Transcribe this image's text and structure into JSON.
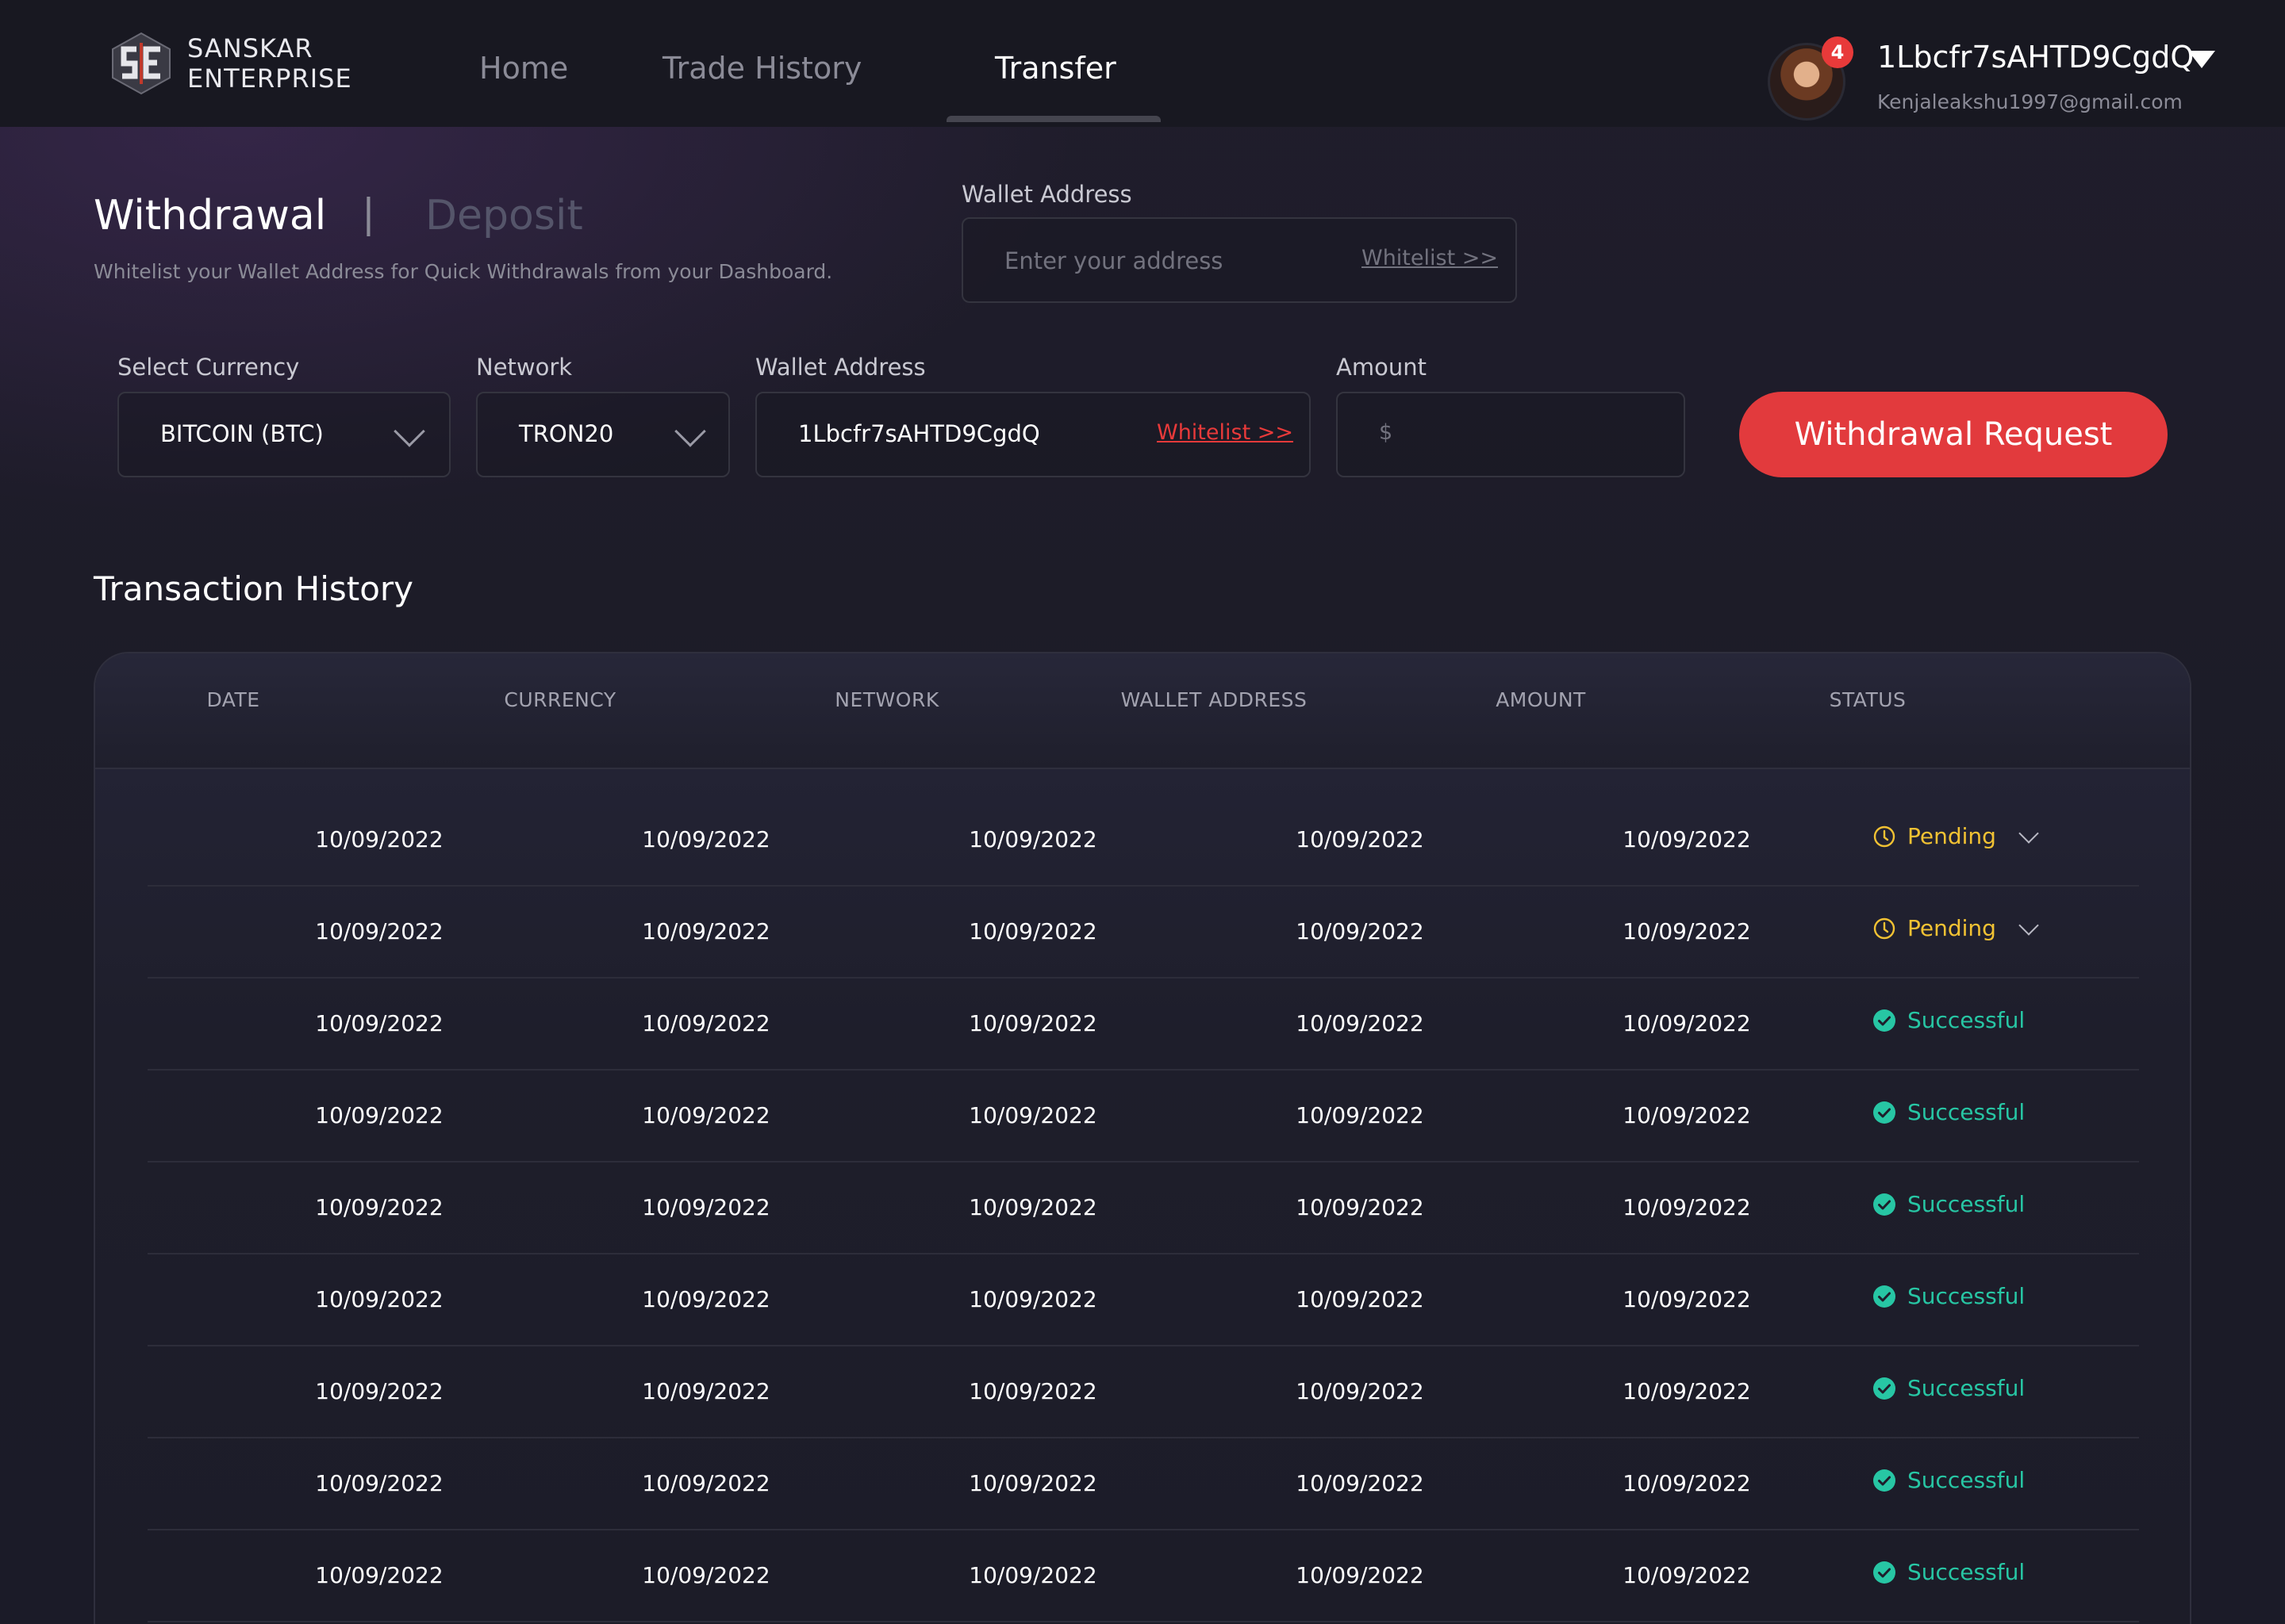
{
  "brand": {
    "name_line1": "SANSKAR",
    "name_line2": "ENTERPRISE"
  },
  "nav": {
    "home": "Home",
    "trade_history": "Trade History",
    "transfer": "Transfer",
    "active": "Transfer"
  },
  "user": {
    "name": "1Lbcfr7sAHTD9CgdQ",
    "email": "Kenjaleakshu1997@gmail.com",
    "notifications": "4"
  },
  "tabs": {
    "withdrawal": "Withdrawal",
    "separator": "|",
    "deposit": "Deposit",
    "active": "Withdrawal"
  },
  "subtitle": "Whitelist your Wallet Address for Quick Withdrawals from your Dashboard.",
  "top_wallet": {
    "label": "Wallet Address",
    "placeholder": "Enter your address",
    "whitelist_link": "Whitelist >>"
  },
  "form": {
    "currency_label": "Select Currency",
    "currency_value": "BITCOIN (BTC)",
    "network_label": "Network",
    "network_value": "TRON20",
    "wallet_label": "Wallet Address",
    "wallet_value": "1Lbcfr7sAHTD9CgdQ",
    "wallet_whitelist": "Whitelist >>",
    "amount_label": "Amount",
    "amount_symbol": "$",
    "submit": "Withdrawal Request",
    "accent_color": "#e23a3d"
  },
  "history": {
    "title": "Transaction  History",
    "columns": [
      "DATE",
      "CURRENCY",
      "NETWORK",
      "WALLET ADDRESS",
      "AMOUNT",
      "STATUS"
    ],
    "status_colors": {
      "pending": "#f2c233",
      "successful": "#27c6a4"
    },
    "rows": [
      {
        "date": "10/09/2022",
        "currency": "10/09/2022",
        "network": "10/09/2022",
        "wallet": "10/09/2022",
        "amount": "10/09/2022",
        "status": "Pending",
        "status_type": "pending",
        "icon": "clock-icon"
      },
      {
        "date": "10/09/2022",
        "currency": "10/09/2022",
        "network": "10/09/2022",
        "wallet": "10/09/2022",
        "amount": "10/09/2022",
        "status": "Pending",
        "status_type": "pending",
        "icon": "clock-icon"
      },
      {
        "date": "10/09/2022",
        "currency": "10/09/2022",
        "network": "10/09/2022",
        "wallet": "10/09/2022",
        "amount": "10/09/2022",
        "status": "Successful",
        "status_type": "successful",
        "icon": "check-circle-icon"
      },
      {
        "date": "10/09/2022",
        "currency": "10/09/2022",
        "network": "10/09/2022",
        "wallet": "10/09/2022",
        "amount": "10/09/2022",
        "status": "Successful",
        "status_type": "successful",
        "icon": "check-circle-icon"
      },
      {
        "date": "10/09/2022",
        "currency": "10/09/2022",
        "network": "10/09/2022",
        "wallet": "10/09/2022",
        "amount": "10/09/2022",
        "status": "Successful",
        "status_type": "successful",
        "icon": "check-circle-icon"
      },
      {
        "date": "10/09/2022",
        "currency": "10/09/2022",
        "network": "10/09/2022",
        "wallet": "10/09/2022",
        "amount": "10/09/2022",
        "status": "Successful",
        "status_type": "successful",
        "icon": "check-circle-icon"
      },
      {
        "date": "10/09/2022",
        "currency": "10/09/2022",
        "network": "10/09/2022",
        "wallet": "10/09/2022",
        "amount": "10/09/2022",
        "status": "Successful",
        "status_type": "successful",
        "icon": "check-circle-icon"
      },
      {
        "date": "10/09/2022",
        "currency": "10/09/2022",
        "network": "10/09/2022",
        "wallet": "10/09/2022",
        "amount": "10/09/2022",
        "status": "Successful",
        "status_type": "successful",
        "icon": "check-circle-icon"
      },
      {
        "date": "10/09/2022",
        "currency": "10/09/2022",
        "network": "10/09/2022",
        "wallet": "10/09/2022",
        "amount": "10/09/2022",
        "status": "Successful",
        "status_type": "successful",
        "icon": "check-circle-icon"
      }
    ]
  }
}
